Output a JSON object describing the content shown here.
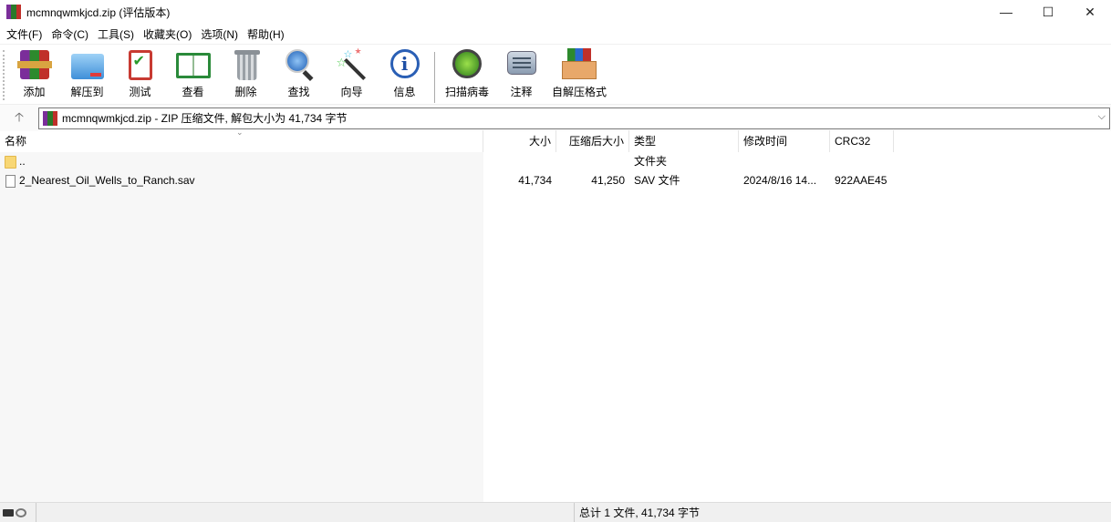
{
  "window": {
    "title": "mcmnqwmkjcd.zip (评估版本)",
    "minimize": "—",
    "maximize": "☐",
    "close": "✕"
  },
  "menu": [
    "文件(F)",
    "命令(C)",
    "工具(S)",
    "收藏夹(O)",
    "选项(N)",
    "帮助(H)"
  ],
  "toolbar": [
    {
      "id": "add",
      "label": "添加",
      "icon": "add-archive-icon"
    },
    {
      "id": "extract",
      "label": "解压到",
      "icon": "extract-folder-icon"
    },
    {
      "id": "test",
      "label": "测试",
      "icon": "test-clipboard-icon"
    },
    {
      "id": "view",
      "label": "查看",
      "icon": "view-book-icon"
    },
    {
      "id": "delete",
      "label": "删除",
      "icon": "trash-icon"
    },
    {
      "id": "find",
      "label": "查找",
      "icon": "magnifier-icon"
    },
    {
      "id": "wizard",
      "label": "向导",
      "icon": "wand-icon"
    },
    {
      "id": "info",
      "label": "信息",
      "icon": "info-icon"
    },
    {
      "id": "virus",
      "label": "扫描病毒",
      "icon": "virus-scan-icon"
    },
    {
      "id": "comment",
      "label": "注释",
      "icon": "comment-icon"
    },
    {
      "id": "sfx",
      "label": "自解压格式",
      "icon": "sfx-box-icon"
    }
  ],
  "address": {
    "up": "🡡",
    "path": "mcmnqwmkjcd.zip - ZIP 压缩文件, 解包大小为 41,734 字节",
    "dropdown": "⌵"
  },
  "columns": [
    "名称",
    "大小",
    "压缩后大小",
    "类型",
    "修改时间",
    "CRC32"
  ],
  "rows": [
    {
      "name": "..",
      "size": "",
      "packed": "",
      "type": "文件夹",
      "modified": "",
      "crc": "",
      "kind": "folder"
    },
    {
      "name": "2_Nearest_Oil_Wells_to_Ranch.sav",
      "size": "41,734",
      "packed": "41,250",
      "type": "SAV 文件",
      "modified": "2024/8/16 14...",
      "crc": "922AAE45",
      "kind": "file"
    }
  ],
  "status": {
    "summary": "总计 1 文件, 41,734 字节"
  },
  "colors": {
    "accent": "#0b5fbf"
  }
}
